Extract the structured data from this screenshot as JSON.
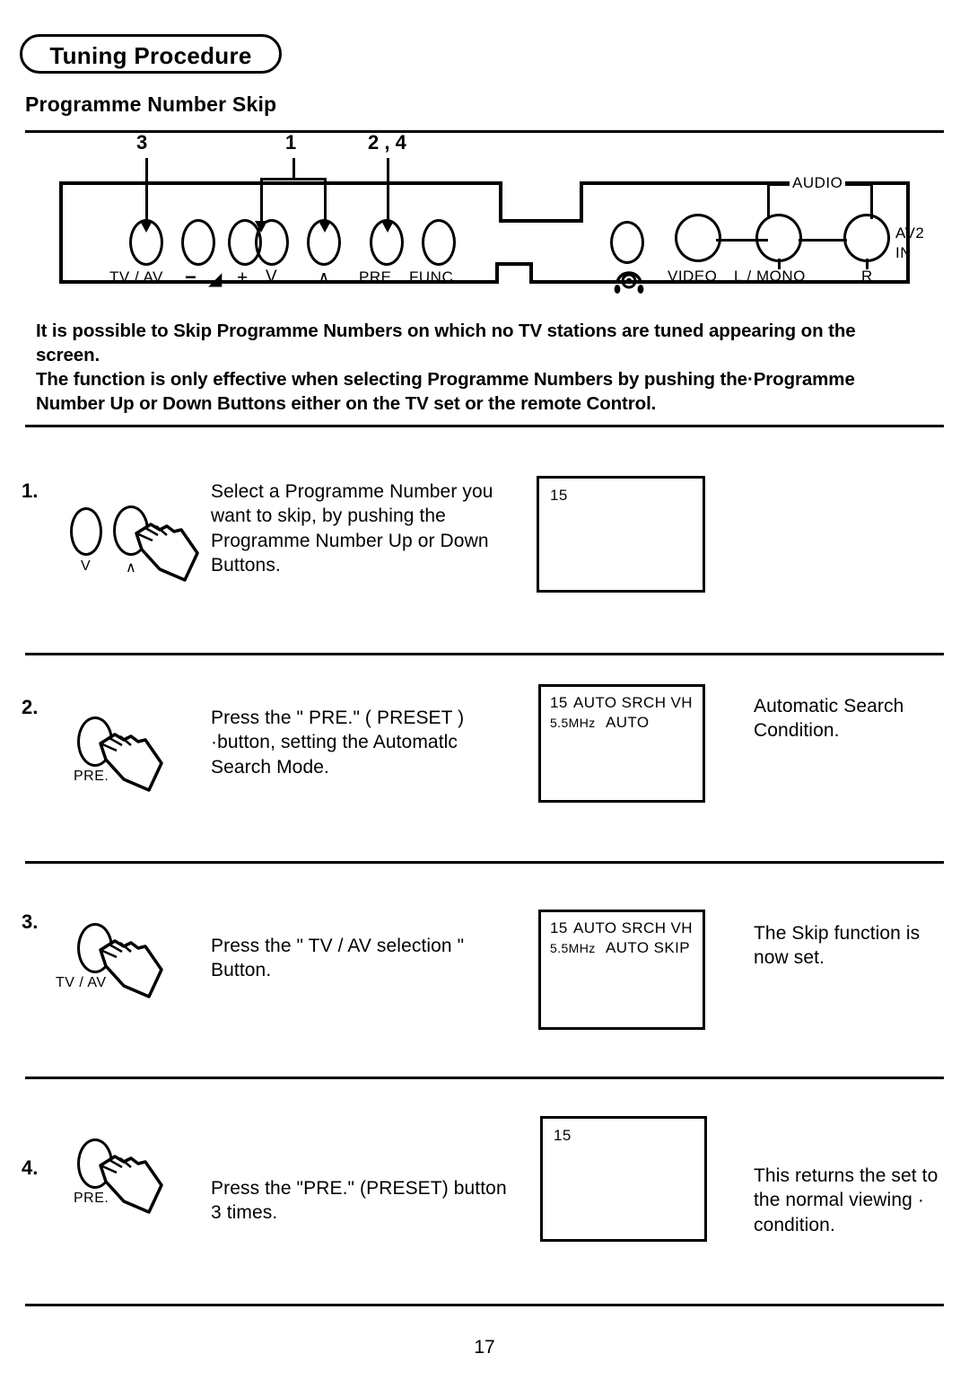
{
  "header": {
    "section_title": "Tuning Procedure",
    "subtitle": "Programme Number Skip"
  },
  "panel_diagram": {
    "callouts": [
      {
        "label": "3",
        "target": "TV / AV"
      },
      {
        "label": "1",
        "target": "V and ∧"
      },
      {
        "label": "2 , 4",
        "target": "PRE."
      }
    ],
    "buttons": [
      {
        "label": "TV / AV",
        "name": "tv-av-button"
      },
      {
        "label": "−",
        "name": "volume-down-button"
      },
      {
        "label": "+",
        "name": "volume-up-button"
      },
      {
        "label": "V",
        "name": "programme-down-button"
      },
      {
        "label": "∧",
        "name": "programme-up-button"
      },
      {
        "label": "PRE.",
        "name": "preset-button"
      },
      {
        "label": "FUNC.",
        "name": "function-button"
      }
    ],
    "volume_symbol": "◢",
    "headphone_jack": "headphone-icon",
    "av_section": {
      "audio_bracket_label": "AUDIO",
      "input_label_line1": "AV2",
      "input_label_line2": "IN",
      "jacks": [
        {
          "label": "VIDEO",
          "name": "video-jack"
        },
        {
          "label": "L / MONO",
          "name": "audio-left-mono-jack"
        },
        {
          "label": "R",
          "name": "audio-right-jack"
        }
      ]
    }
  },
  "intro": {
    "line1": "It is possible to Skip Programme Numbers on which no TV stations are tuned appearing on the",
    "line2": "screen.",
    "line3": "The function is only effective when selecting Programme Numbers by pushing the·Programme",
    "line4": "Number Up or Down Buttons either on the TV set or the remote Control."
  },
  "steps": [
    {
      "number": "1.",
      "icon_buttons": [
        {
          "label": "V",
          "name": "programme-down-button-icon"
        },
        {
          "label": "∧",
          "name": "programme-up-button-icon"
        }
      ],
      "instruction": [
        "Select a Programme Number you",
        "want to skip, by pushing the",
        "Programme Number Up  or Down",
        "Buttons."
      ],
      "screen": {
        "line1_num": "15",
        "line1_rest": "",
        "line2": ""
      },
      "note": []
    },
    {
      "number": "2.",
      "icon_buttons": [
        {
          "label": "PRE.",
          "name": "preset-button-icon"
        }
      ],
      "instruction": [
        "Press the \" PRE.\" ( PRESET )",
        "·button, setting the Automatlc",
        "Search Mode."
      ],
      "screen": {
        "line1_num": "15",
        "line1_rest": "AUTO SRCH  VH",
        "line2_freq": "5.5MHz",
        "line2_rest": "AUTO"
      },
      "note": [
        "Automatic Search",
        "Condition."
      ]
    },
    {
      "number": "3.",
      "icon_buttons": [
        {
          "label": "TV / AV",
          "name": "tv-av-button-icon"
        }
      ],
      "instruction": [
        "Press the \" TV / AV selection \"",
        "Button."
      ],
      "screen": {
        "line1_num": "15",
        "line1_rest": "AUTO SRCH  VH",
        "line2_freq": "5.5MHz",
        "line2_rest": "AUTO SKIP"
      },
      "note": [
        "The Skip function is",
        "now set."
      ]
    },
    {
      "number": "4.",
      "icon_buttons": [
        {
          "label": "PRE.",
          "name": "preset-button-icon"
        }
      ],
      "instruction": [
        "Press the \"PRE.\" (PRESET) button",
        "3 times."
      ],
      "screen": {
        "line1_num": "15",
        "line1_rest": "",
        "line2": ""
      },
      "note": [
        "This returns the set to",
        "the  normal viewing ·",
        "condition."
      ]
    }
  ],
  "footer": {
    "page_number": "17"
  },
  "colors": {
    "ink": "#000000",
    "paper": "#ffffff"
  }
}
